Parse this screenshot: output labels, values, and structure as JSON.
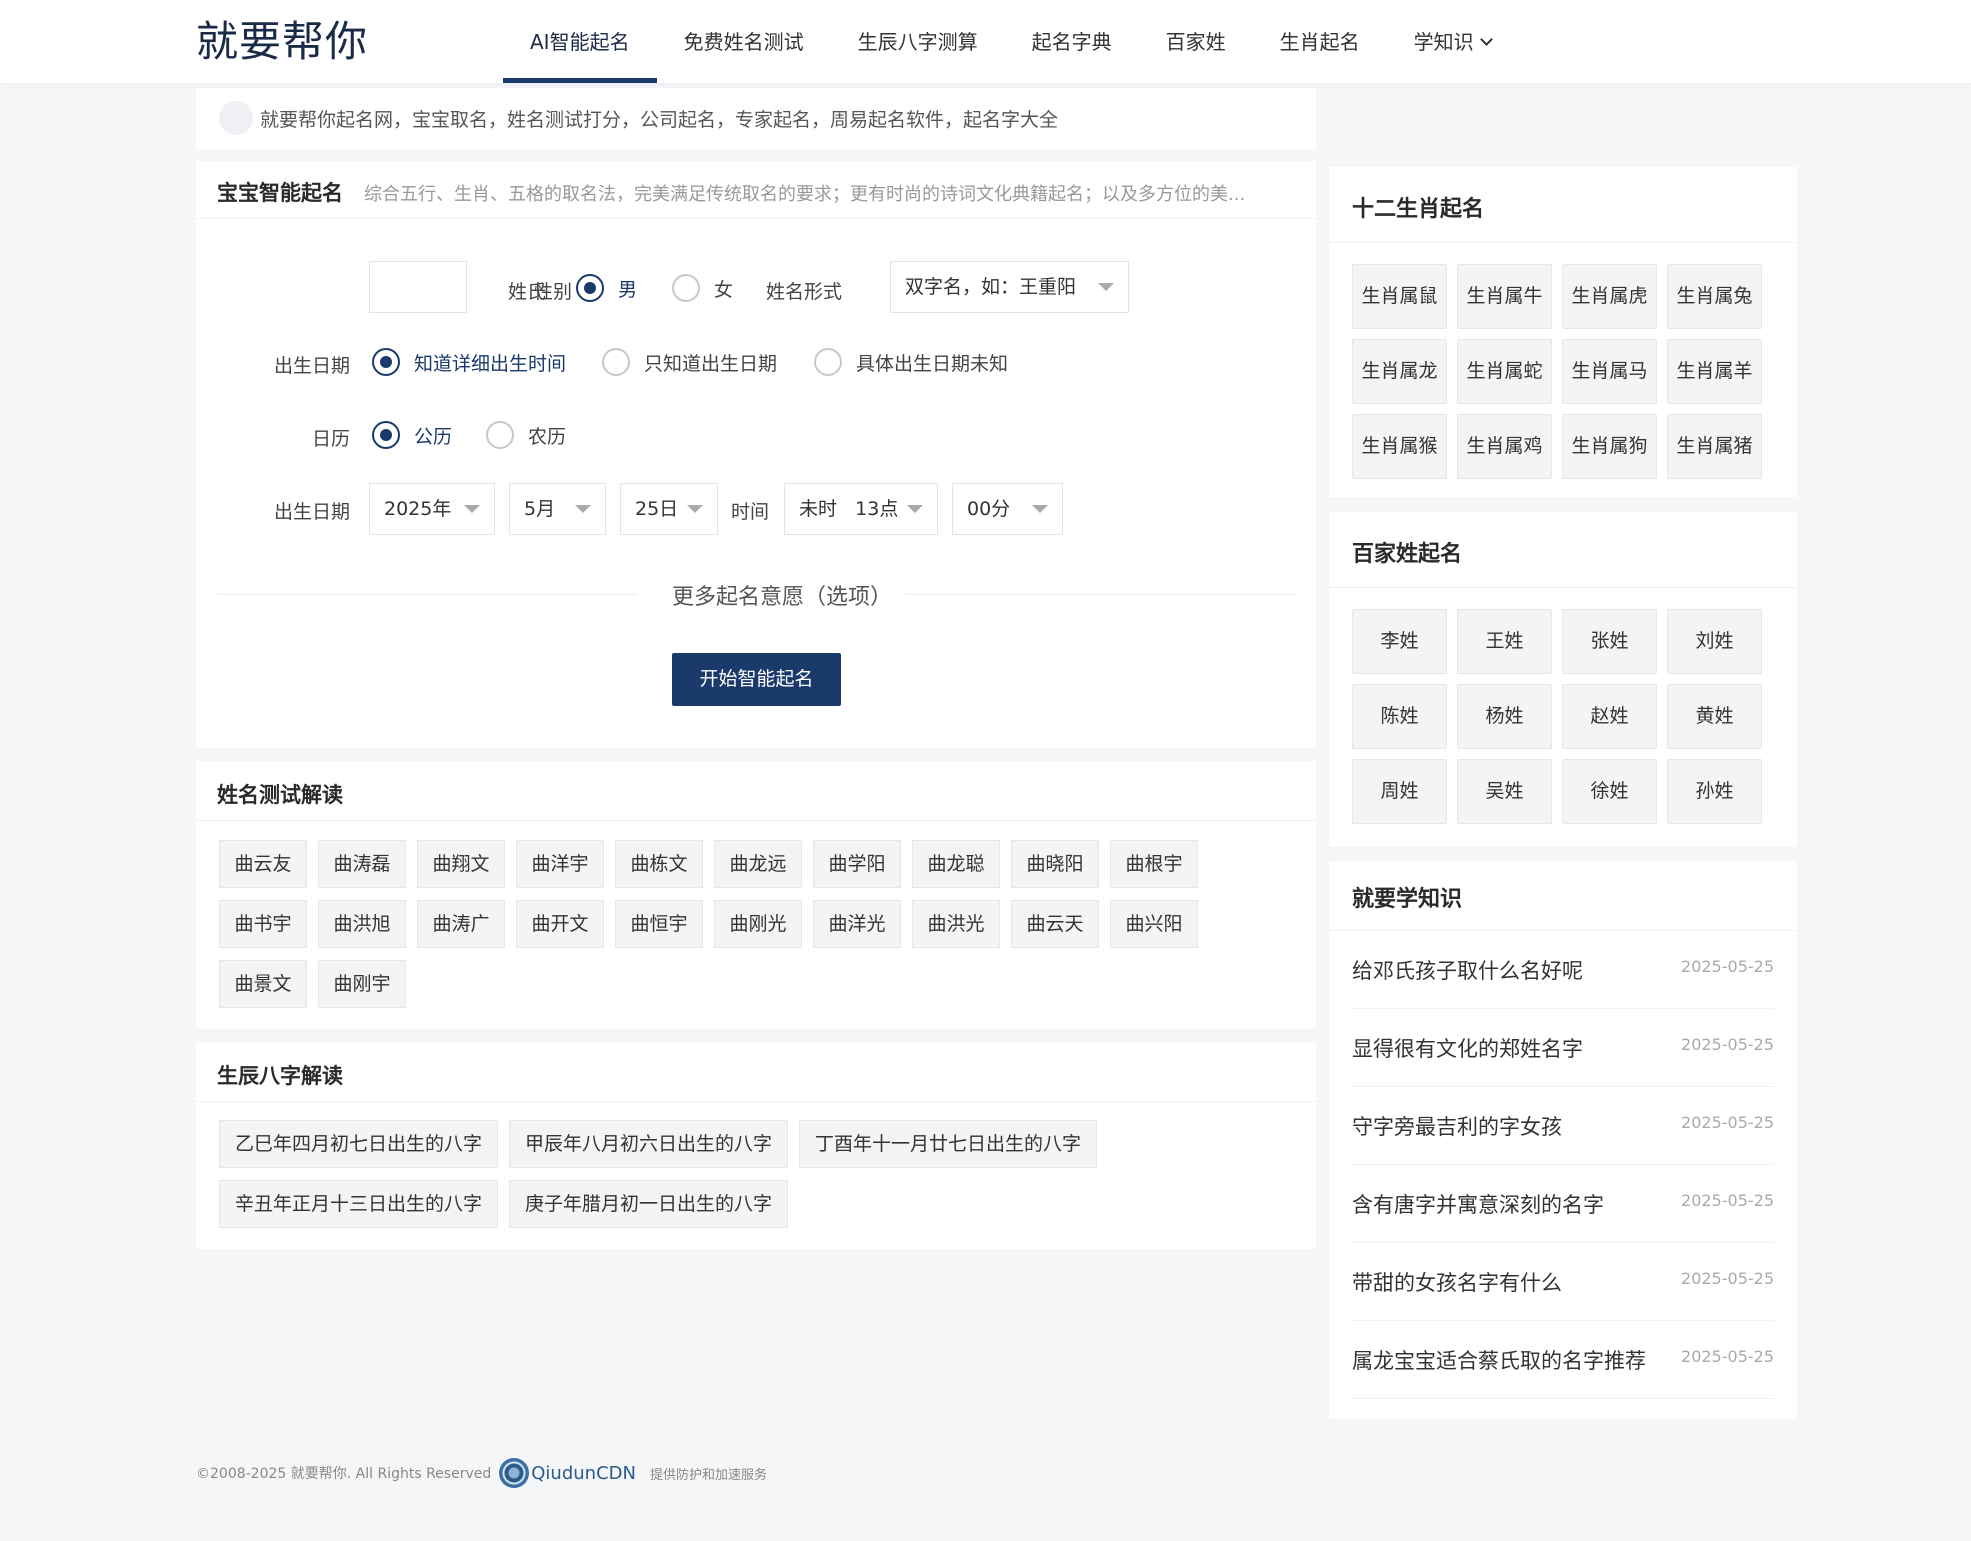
{
  "header": {
    "logo": "就要帮你",
    "nav": [
      {
        "label": "AI智能起名",
        "active": true
      },
      {
        "label": "免费姓名测试"
      },
      {
        "label": "生辰八字测算"
      },
      {
        "label": "起名字典"
      },
      {
        "label": "百家姓"
      },
      {
        "label": "生肖起名"
      },
      {
        "label": "学知识",
        "dropdown": true
      }
    ]
  },
  "notice": {
    "text": "就要帮你起名网，宝宝取名，姓名测试打分，公司起名，专家起名，周易起名软件，起名字大全"
  },
  "naming_form": {
    "title": "宝宝智能起名",
    "subtitle": "综合五行、生肖、五格的取名法，完美满足传统取名的要求；更有时尚的诗词文化典籍起名；以及多方位的美...",
    "surname_label": "姓氏",
    "surname_value": "",
    "gender_label": "性别",
    "gender_male": "男",
    "gender_female": "女",
    "gender_selected": "男",
    "name_form_label": "姓名形式",
    "name_form_value": "双字名，如：王重阳",
    "birth_label": "出生日期",
    "birth_options": [
      "知道详细出生时间",
      "只知道出生日期",
      "具体出生日期未知"
    ],
    "birth_selected": "知道详细出生时间",
    "calendar_label": "日历",
    "calendar_solar": "公历",
    "calendar_lunar": "农历",
    "calendar_selected": "公历",
    "date_label": "出生日期",
    "year": "2025年",
    "month": "5月",
    "day": "25日",
    "time_label": "时间",
    "hour_branch": "未时",
    "hour": "13点",
    "minute": "00分",
    "more_wish": "更多起名意愿（选项）",
    "submit": "开始智能起名"
  },
  "name_test": {
    "title": "姓名测试解读",
    "names": [
      "曲云友",
      "曲涛磊",
      "曲翔文",
      "曲洋宇",
      "曲栋文",
      "曲龙远",
      "曲学阳",
      "曲龙聪",
      "曲晓阳",
      "曲根宇",
      "曲书宇",
      "曲洪旭",
      "曲涛广",
      "曲开文",
      "曲恒宇",
      "曲刚光",
      "曲洋光",
      "曲洪光",
      "曲云天",
      "曲兴阳",
      "曲景文",
      "曲刚宇"
    ]
  },
  "bazi": {
    "title": "生辰八字解读",
    "items": [
      "乙巳年四月初七日出生的八字",
      "甲辰年八月初六日出生的八字",
      "丁酉年十一月廿七日出生的八字",
      "辛丑年正月十三日出生的八字",
      "庚子年腊月初一日出生的八字"
    ]
  },
  "zodiac": {
    "title": "十二生肖起名",
    "items": [
      "生肖属鼠",
      "生肖属牛",
      "生肖属虎",
      "生肖属兔",
      "生肖属龙",
      "生肖属蛇",
      "生肖属马",
      "生肖属羊",
      "生肖属猴",
      "生肖属鸡",
      "生肖属狗",
      "生肖属猪"
    ]
  },
  "surnames": {
    "title": "百家姓起名",
    "items": [
      "李姓",
      "王姓",
      "张姓",
      "刘姓",
      "陈姓",
      "杨姓",
      "赵姓",
      "黄姓",
      "周姓",
      "吴姓",
      "徐姓",
      "孙姓"
    ]
  },
  "knowledge": {
    "title": "就要学知识",
    "articles": [
      {
        "title": "给邓氏孩子取什么名好呢",
        "date": "2025-05-25"
      },
      {
        "title": "显得很有文化的郑姓名字",
        "date": "2025-05-25"
      },
      {
        "title": "守字旁最吉利的字女孩",
        "date": "2025-05-25"
      },
      {
        "title": "含有唐字并寓意深刻的名字",
        "date": "2025-05-25"
      },
      {
        "title": "带甜的女孩名字有什么",
        "date": "2025-05-25"
      },
      {
        "title": "属龙宝宝适合蔡氏取的名字推荐",
        "date": "2025-05-25"
      }
    ]
  },
  "footer": {
    "copyright": "©2008-2025 就要帮你. All Rights Reserved",
    "cdn_name": "QiudunCDN",
    "cdn_desc": "提供防护和加速服务"
  },
  "colors": {
    "primary": "#1a3a6c",
    "background": "#f5f6f8"
  }
}
